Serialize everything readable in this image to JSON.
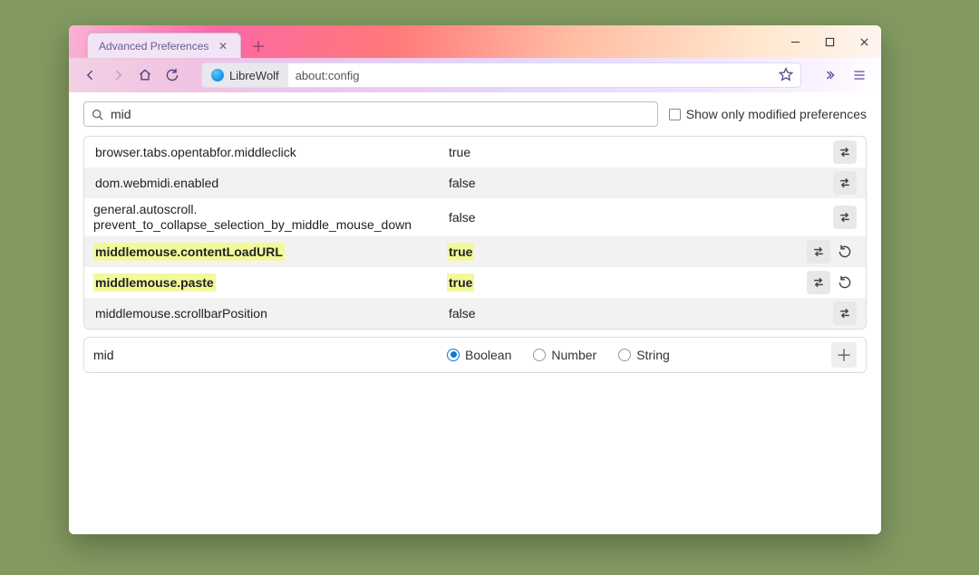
{
  "tab": {
    "title": "Advanced Preferences"
  },
  "identity_label": "LibreWolf",
  "url": "about:config",
  "search": {
    "value": "mid"
  },
  "show_modified_label": "Show only modified preferences",
  "prefs": [
    {
      "name": "browser.tabs.opentabfor.middleclick",
      "value": "true",
      "striped": false,
      "modified": false,
      "reset": false,
      "multiline": false
    },
    {
      "name": "dom.webmidi.enabled",
      "value": "false",
      "striped": true,
      "modified": false,
      "reset": false,
      "multiline": false
    },
    {
      "name": "general.autoscroll.",
      "name2": "prevent_to_collapse_selection_by_middle_mouse_down",
      "value": "false",
      "striped": false,
      "modified": false,
      "reset": false,
      "multiline": true
    },
    {
      "name": "middlemouse.contentLoadURL",
      "value": "true",
      "striped": true,
      "modified": true,
      "reset": true,
      "multiline": false
    },
    {
      "name": "middlemouse.paste",
      "value": "true",
      "striped": false,
      "modified": true,
      "reset": true,
      "multiline": false
    },
    {
      "name": "middlemouse.scrollbarPosition",
      "value": "false",
      "striped": true,
      "modified": false,
      "reset": false,
      "multiline": false
    }
  ],
  "newpref": {
    "name": "mid",
    "types": [
      "Boolean",
      "Number",
      "String"
    ],
    "selected": "Boolean"
  }
}
